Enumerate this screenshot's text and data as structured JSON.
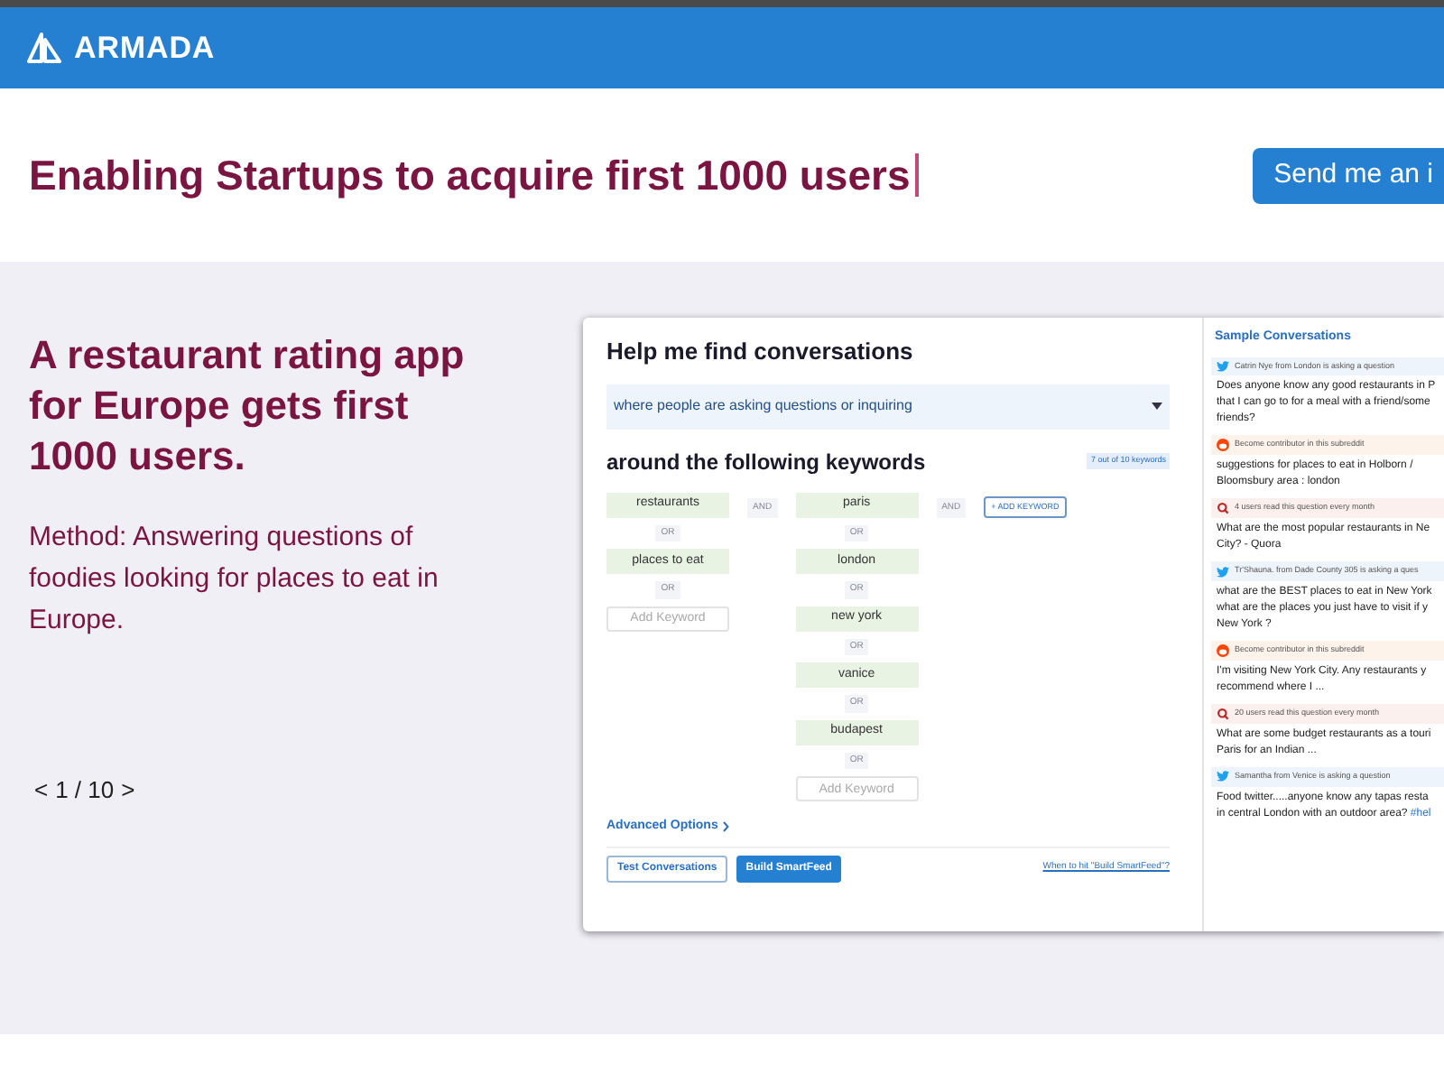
{
  "header": {
    "brand": "ARMADA"
  },
  "hero": {
    "headline": "Enabling Startups to acquire first 1000 users",
    "cta": "Send me an i"
  },
  "case": {
    "title": "A restaurant rating app for Europe gets first 1000 users.",
    "method": "Method: Answering questions of foodies looking for places to eat in Europe.",
    "pager": {
      "prev": "<",
      "current": "1 / 10",
      "next": ">"
    }
  },
  "app": {
    "title": "Help me find conversations",
    "dropdown": "where people are asking questions or inquiring",
    "keywords_title": "around the following keywords",
    "keyword_count": "7 out of 10 keywords",
    "keyword_row": [
      {
        "kind": "group",
        "items": [
          {
            "kind": "keyword",
            "label": "restaurants"
          },
          {
            "kind": "or",
            "label": "OR"
          },
          {
            "kind": "keyword",
            "label": "places to eat"
          },
          {
            "kind": "or",
            "label": "OR"
          },
          {
            "kind": "input",
            "placeholder": "Add Keyword"
          }
        ]
      },
      {
        "kind": "and",
        "label": "AND"
      },
      {
        "kind": "group",
        "items": [
          {
            "kind": "keyword",
            "label": "paris"
          },
          {
            "kind": "or",
            "label": "OR"
          },
          {
            "kind": "keyword",
            "label": "london"
          },
          {
            "kind": "or",
            "label": "OR"
          },
          {
            "kind": "keyword",
            "label": "new york"
          },
          {
            "kind": "or",
            "label": "OR"
          },
          {
            "kind": "keyword",
            "label": "vanice"
          },
          {
            "kind": "or",
            "label": "OR"
          },
          {
            "kind": "keyword",
            "label": "budapest"
          },
          {
            "kind": "or",
            "label": "OR"
          },
          {
            "kind": "input",
            "placeholder": "Add Keyword"
          }
        ]
      },
      {
        "kind": "and",
        "label": "AND"
      },
      {
        "kind": "button",
        "label": "+ ADD KEYWORD"
      }
    ],
    "advanced": "Advanced Options",
    "test_button": "Test Conversations",
    "build_button": "Build SmartFeed",
    "help_link": "When to hit \"Build SmartFeed\"?",
    "samples_title": "Sample Conversations",
    "samples": [
      {
        "kind": "twitter",
        "source": "Catrin Nye from London is asking a question",
        "text": "Does anyone know any good restaurants in P that I can go to for a meal with a friend/some friends?"
      },
      {
        "kind": "reddit",
        "source": "Become contributor in this subreddit",
        "text": "suggestions for places to eat in Holborn / Bloomsbury area : london"
      },
      {
        "kind": "quora",
        "source": "4 users read this question every month",
        "text": "What are the most popular restaurants in Ne City? - Quora"
      },
      {
        "kind": "twitter",
        "source": "Tr'Shauna. from Dade County 305 is asking a ques",
        "text": "what are the BEST places to eat in New York what are the places you just have to visit if y New York ?"
      },
      {
        "kind": "reddit",
        "source": "Become contributor in this subreddit",
        "text": "I'm visiting New York City. Any restaurants y recommend where I ..."
      },
      {
        "kind": "quora",
        "source": "20 users read this question every month",
        "text": "What are some budget restaurants as a touri Paris for an Indian ..."
      },
      {
        "kind": "twitter",
        "source": "Samantha from Venice is asking a question",
        "text": "Food twitter.....anyone know any tapas resta in central London with an outdoor area?",
        "tag": "#hel"
      }
    ]
  }
}
